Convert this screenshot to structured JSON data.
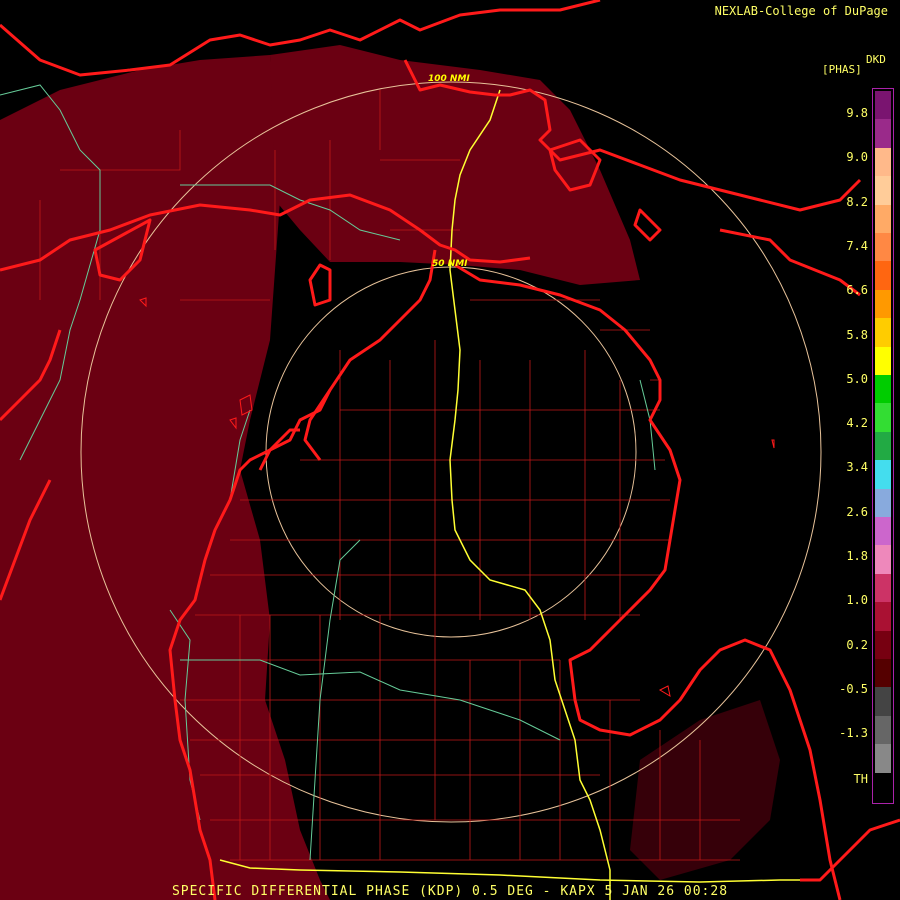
{
  "header": {
    "credit": "NEXLAB-College of DuPage",
    "units_top": "DKD",
    "units_main": "[PHAS]"
  },
  "footer": {
    "product": "SPECIFIC DIFFERENTIAL PHASE (KDP) 0.5 DEG - KAPX 5 JAN 26 00:28"
  },
  "range_rings": [
    {
      "label": "100 NMI"
    },
    {
      "label": "50 NMI"
    }
  ],
  "legend": {
    "ticks": [
      "9.8",
      "9.0",
      "8.2",
      "7.4",
      "6.6",
      "5.8",
      "5.0",
      "4.2",
      "3.4",
      "2.6",
      "1.8",
      "1.0",
      "0.2",
      "-0.5",
      "-1.3",
      "TH"
    ],
    "colors": [
      "#7a1470",
      "#9a2a8a",
      "#ffb98a",
      "#ffcc99",
      "#ffaa66",
      "#ff8844",
      "#ff6611",
      "#ff9900",
      "#ffcc00",
      "#ffff00",
      "#00cc00",
      "#33dd33",
      "#22aa44",
      "#44ddee",
      "#88aadd",
      "#cc66cc",
      "#ee88bb",
      "#cc3366",
      "#aa1133",
      "#770011",
      "#550000",
      "#444444",
      "#666666",
      "#888888",
      "#000000"
    ]
  },
  "colors": {
    "echo": "#6b0012",
    "state_lines": "#ff1a1a",
    "county_lines": "#c01818",
    "highways": "#ffff33",
    "roads": "#66cc99",
    "range_ring": "#e8c39a"
  }
}
